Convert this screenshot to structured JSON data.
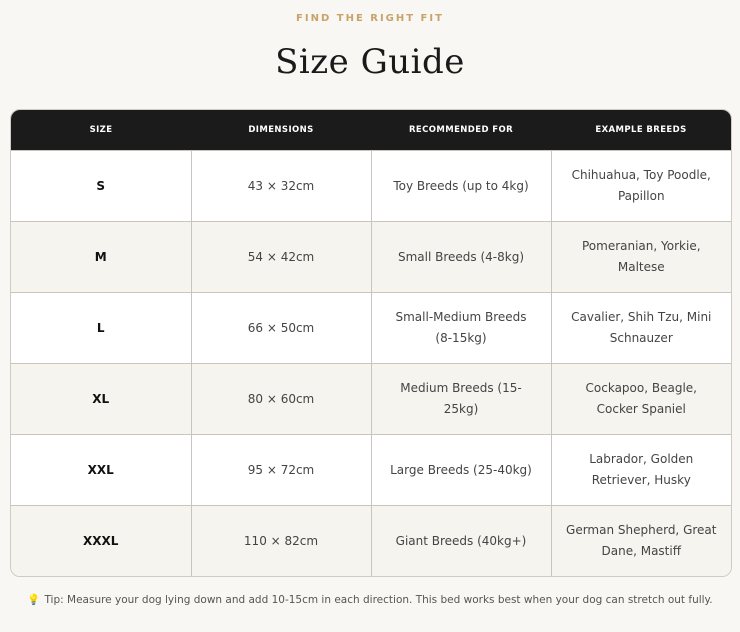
{
  "header": {
    "eyebrow": "FIND THE RIGHT FIT",
    "title": "Size Guide"
  },
  "table": {
    "columns": [
      "SIZE",
      "DIMENSIONS",
      "RECOMMENDED FOR",
      "EXAMPLE BREEDS"
    ],
    "rows": [
      {
        "size": "S",
        "dimensions": "43 × 32cm",
        "recommended": "Toy Breeds (up to 4kg)",
        "breeds": "Chihuahua, Toy Poodle, Papillon"
      },
      {
        "size": "M",
        "dimensions": "54 × 42cm",
        "recommended": "Small Breeds (4-8kg)",
        "breeds": "Pomeranian, Yorkie, Maltese"
      },
      {
        "size": "L",
        "dimensions": "66 × 50cm",
        "recommended": "Small-Medium Breeds (8-15kg)",
        "breeds": "Cavalier, Shih Tzu, Mini Schnauzer"
      },
      {
        "size": "XL",
        "dimensions": "80 × 60cm",
        "recommended": "Medium Breeds (15-25kg)",
        "breeds": "Cockapoo, Beagle, Cocker Spaniel"
      },
      {
        "size": "XXL",
        "dimensions": "95 × 72cm",
        "recommended": "Large Breeds (25-40kg)",
        "breeds": "Labrador, Golden Retriever, Husky"
      },
      {
        "size": "XXXL",
        "dimensions": "110 × 82cm",
        "recommended": "Giant Breeds (40kg+)",
        "breeds": "German Shepherd, Great Dane, Mastiff"
      }
    ]
  },
  "tip": {
    "icon": "lightbulb-icon",
    "text": "Tip: Measure your dog lying down and add 10-15cm in each direction. This bed works best when your dog can stretch out fully."
  },
  "colors": {
    "accent": "#c8a36a",
    "header_bg": "#1b1b1b",
    "page_bg": "#f8f7f3"
  }
}
